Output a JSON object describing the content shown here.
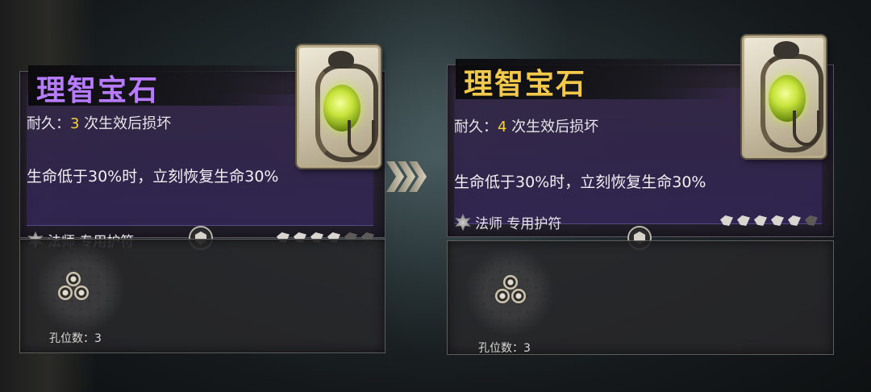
{
  "left_item": {
    "title": "理智宝石",
    "title_color": "#b77bff",
    "durability_label": "耐久：",
    "durability_value": "3",
    "durability_suffix": " 次生效后损坏",
    "effect": "生命低于30%时，立刻恢复生命30%",
    "class_label": "法师 专用护符",
    "stars_filled": 4,
    "stars_total": 6,
    "sockets_label": "孔位数：3",
    "icon": "sanity-gem-card-icon"
  },
  "right_item": {
    "title": "理智宝石",
    "title_color": "#f2c94a",
    "durability_label": "耐久：",
    "durability_value": "4",
    "durability_suffix": " 次生效后损坏",
    "effect": "生命低于30%时，立刻恢复生命30%",
    "class_label": "法师 专用护符",
    "stars_filled": 5,
    "stars_total": 6,
    "sockets_label": "孔位数：3",
    "icon": "sanity-gem-card-icon"
  },
  "upgrade_arrow": "triple-chevron-right-icon"
}
